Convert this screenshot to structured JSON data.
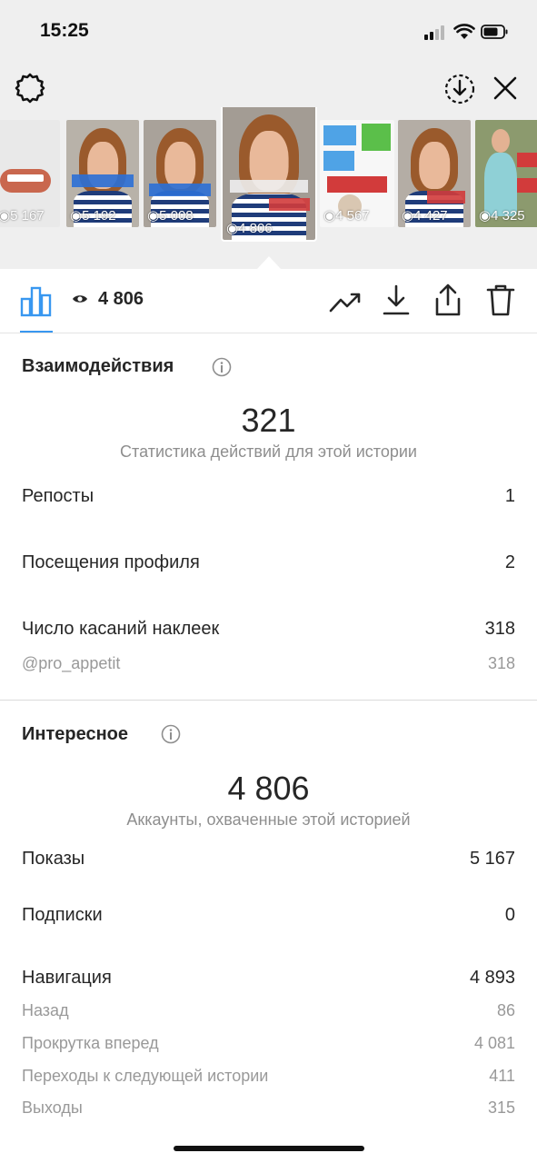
{
  "status_bar": {
    "time": "15:25"
  },
  "stories": [
    {
      "views": "5 167"
    },
    {
      "views": "5 192"
    },
    {
      "views": "5 008"
    },
    {
      "views": "4 806",
      "active": true,
      "sticker": "@pro_appetit"
    },
    {
      "views": "4 567"
    },
    {
      "views": "4 427",
      "sticker": "@pro_appetit"
    },
    {
      "views": "4 325"
    }
  ],
  "toolbar": {
    "views": "4 806"
  },
  "interactions": {
    "title": "Взаимодействия",
    "total": "321",
    "subtitle": "Статистика действий для этой истории",
    "rows": [
      {
        "label": "Репосты",
        "value": "1"
      },
      {
        "label": "Посещения профиля",
        "value": "2"
      },
      {
        "label": "Число касаний наклеек",
        "value": "318"
      }
    ],
    "sticker_row": {
      "label": "@pro_appetit",
      "value": "318"
    }
  },
  "discovery": {
    "title": "Интересное",
    "total": "4 806",
    "subtitle": "Аккаунты, охваченные этой историей",
    "rows": [
      {
        "label": "Показы",
        "value": "5 167"
      },
      {
        "label": "Подписки",
        "value": "0"
      },
      {
        "label": "Навигация",
        "value": "4 893"
      }
    ],
    "navigation": [
      {
        "label": "Назад",
        "value": "86"
      },
      {
        "label": "Прокрутка вперед",
        "value": "4 081"
      },
      {
        "label": "Переходы к следующей истории",
        "value": "411"
      },
      {
        "label": "Выходы",
        "value": "315"
      }
    ]
  },
  "colors": {
    "accent": "#3897f0",
    "background_top": "#efefef",
    "text": "#262626",
    "muted": "#8e8e8e"
  }
}
